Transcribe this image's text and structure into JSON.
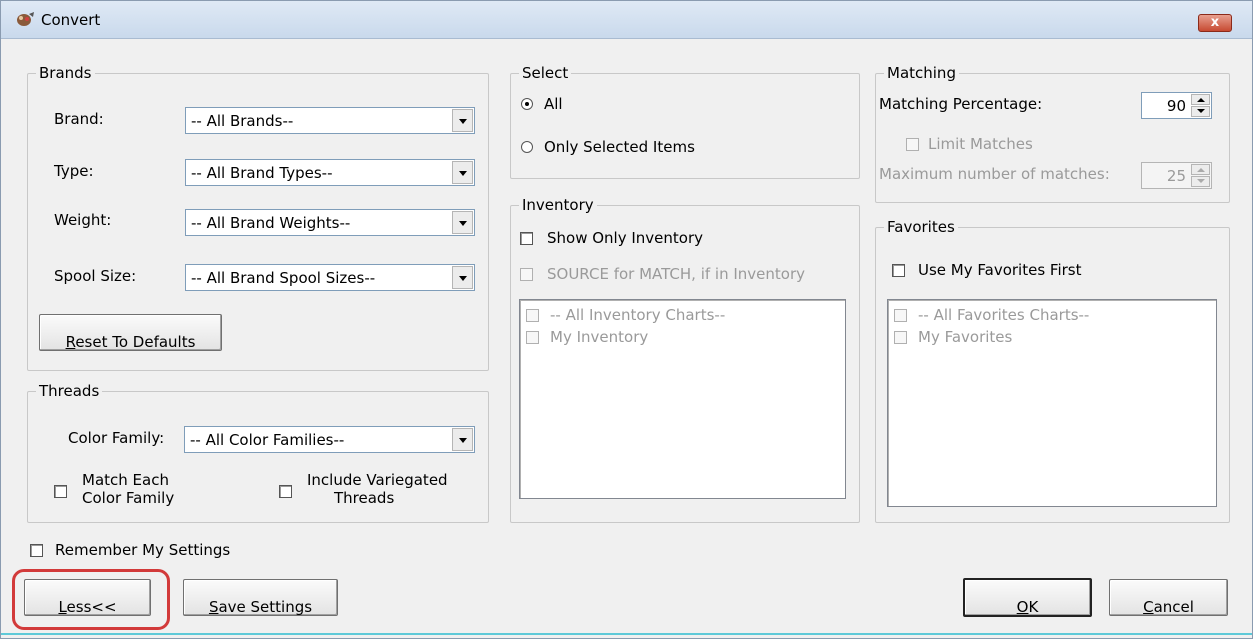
{
  "window": {
    "title": "Convert",
    "close_label": "x"
  },
  "brands": {
    "group_label": "Brands",
    "brand_label": "Brand:",
    "brand_value": "-- All Brands--",
    "type_label": "Type:",
    "type_value": "-- All Brand Types--",
    "weight_label": "Weight:",
    "weight_value": "-- All Brand Weights--",
    "spool_label": "Spool Size:",
    "spool_value": "-- All Brand Spool Sizes--",
    "reset_first": "R",
    "reset_rest": "eset To Defaults"
  },
  "threads": {
    "group_label": "Threads",
    "color_family_label": "Color Family:",
    "color_family_value": "-- All Color Families--",
    "match_each_line1": "Match Each",
    "match_each_line2": "Color Family",
    "include_var_line1": "Include Variegated",
    "include_var_line2": "Threads"
  },
  "select": {
    "group_label": "Select",
    "all_label": "All",
    "only_selected_label": "Only Selected Items"
  },
  "inventory": {
    "group_label": "Inventory",
    "show_only_label": "Show Only Inventory",
    "source_label": "SOURCE for MATCH, if in Inventory",
    "items": [
      "-- All Inventory Charts--",
      "My Inventory"
    ]
  },
  "matching": {
    "group_label": "Matching",
    "percentage_label": "Matching Percentage:",
    "percentage_value": "90",
    "limit_label": "Limit Matches",
    "max_label": "Maximum number of matches:",
    "max_value": "25"
  },
  "favorites": {
    "group_label": "Favorites",
    "use_first_label": "Use My Favorites First",
    "items": [
      "-- All Favorites Charts--",
      "My Favorites"
    ]
  },
  "footer": {
    "remember_label": "Remember My Settings",
    "less_first": "L",
    "less_rest": "ess<<",
    "save_first": "S",
    "save_rest": "ave Settings",
    "ok_first": "O",
    "ok_rest": "K",
    "cancel_first": "C",
    "cancel_rest": "ancel"
  }
}
